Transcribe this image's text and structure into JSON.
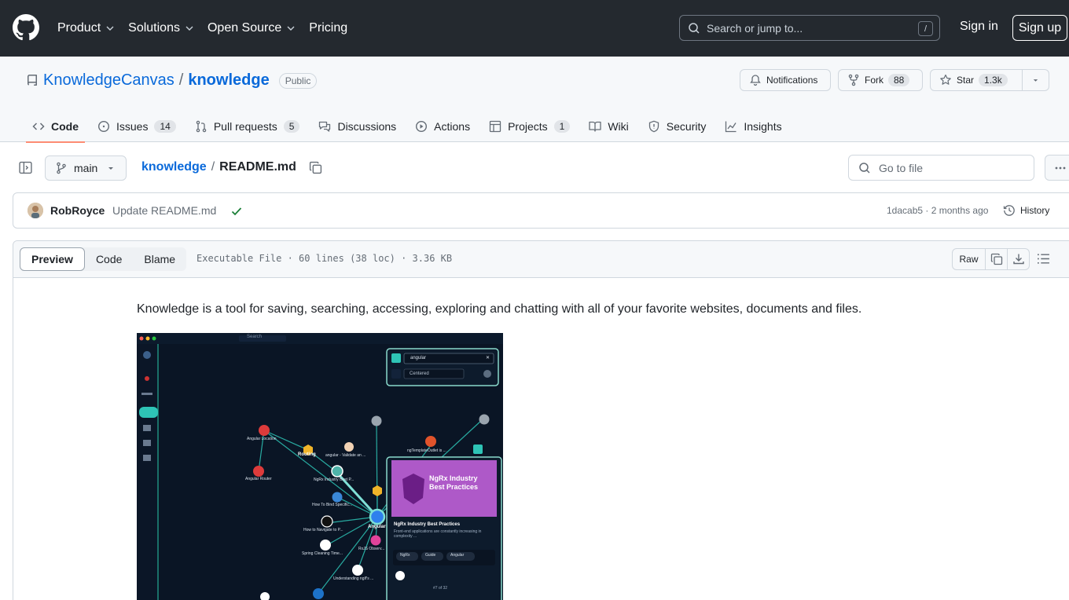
{
  "header": {
    "nav": [
      "Product",
      "Solutions",
      "Open Source",
      "Pricing"
    ],
    "search_placeholder": "Search or jump to...",
    "search_key": "/",
    "sign_in": "Sign in",
    "sign_up": "Sign up"
  },
  "repo": {
    "owner": "KnowledgeCanvas",
    "separator": "/",
    "name": "knowledge",
    "visibility": "Public",
    "notifications": "Notifications",
    "fork_label": "Fork",
    "fork_count": "88",
    "star_label": "Star",
    "star_count": "1.3k"
  },
  "tabs": [
    {
      "label": "Code",
      "count": ""
    },
    {
      "label": "Issues",
      "count": "14"
    },
    {
      "label": "Pull requests",
      "count": "5"
    },
    {
      "label": "Discussions",
      "count": ""
    },
    {
      "label": "Actions",
      "count": ""
    },
    {
      "label": "Projects",
      "count": "1"
    },
    {
      "label": "Wiki",
      "count": ""
    },
    {
      "label": "Security",
      "count": ""
    },
    {
      "label": "Insights",
      "count": ""
    }
  ],
  "file_bar": {
    "branch": "main",
    "crumb_repo": "knowledge",
    "crumb_sep": "/",
    "crumb_file": "README.md",
    "goto_placeholder": "Go to file"
  },
  "commit": {
    "author": "RobRoyce",
    "message": "Update README.md",
    "meta": "1dacab5 · 2 months ago",
    "history": "History"
  },
  "file_view": {
    "modes": [
      "Preview",
      "Code",
      "Blame"
    ],
    "info": "Executable File · 60 lines (38 loc) · 3.36 KB",
    "raw": "Raw"
  },
  "readme": {
    "intro": "Knowledge is a tool for saving, searching, accessing, exploring and chatting with all of your favorite websites, documents and files."
  },
  "screenshot": {
    "search_text": "angular",
    "layout": "Centered",
    "card_title": "NgRx Industry Best Practices",
    "card_banner": "NgRx Industry Best Practices",
    "card_desc": "Front-end applications are constantly increasing in complexity ...",
    "tags": [
      "NgRx",
      "Guide",
      "Angular"
    ],
    "pager": "#7 of 32",
    "nodes": [
      "Angular Location",
      "Routing",
      "angular - Validate an ...",
      "ngTemplateOutlet is ...",
      "Angular Router",
      "NgRx Industry Best P...",
      "How To Bind Specific...",
      "How to Navigate to P...",
      "Angular",
      "RxJS Observ...",
      "Spring Cleaning Time...",
      "Understanding ngIf's ..."
    ],
    "top_search": "Search"
  },
  "colors": {
    "header_bg": "#24292f",
    "link": "#0969da",
    "tab_underline": "#fd8c73",
    "canvas_bg": "#0a1525",
    "teal": "#2ec4b6"
  }
}
